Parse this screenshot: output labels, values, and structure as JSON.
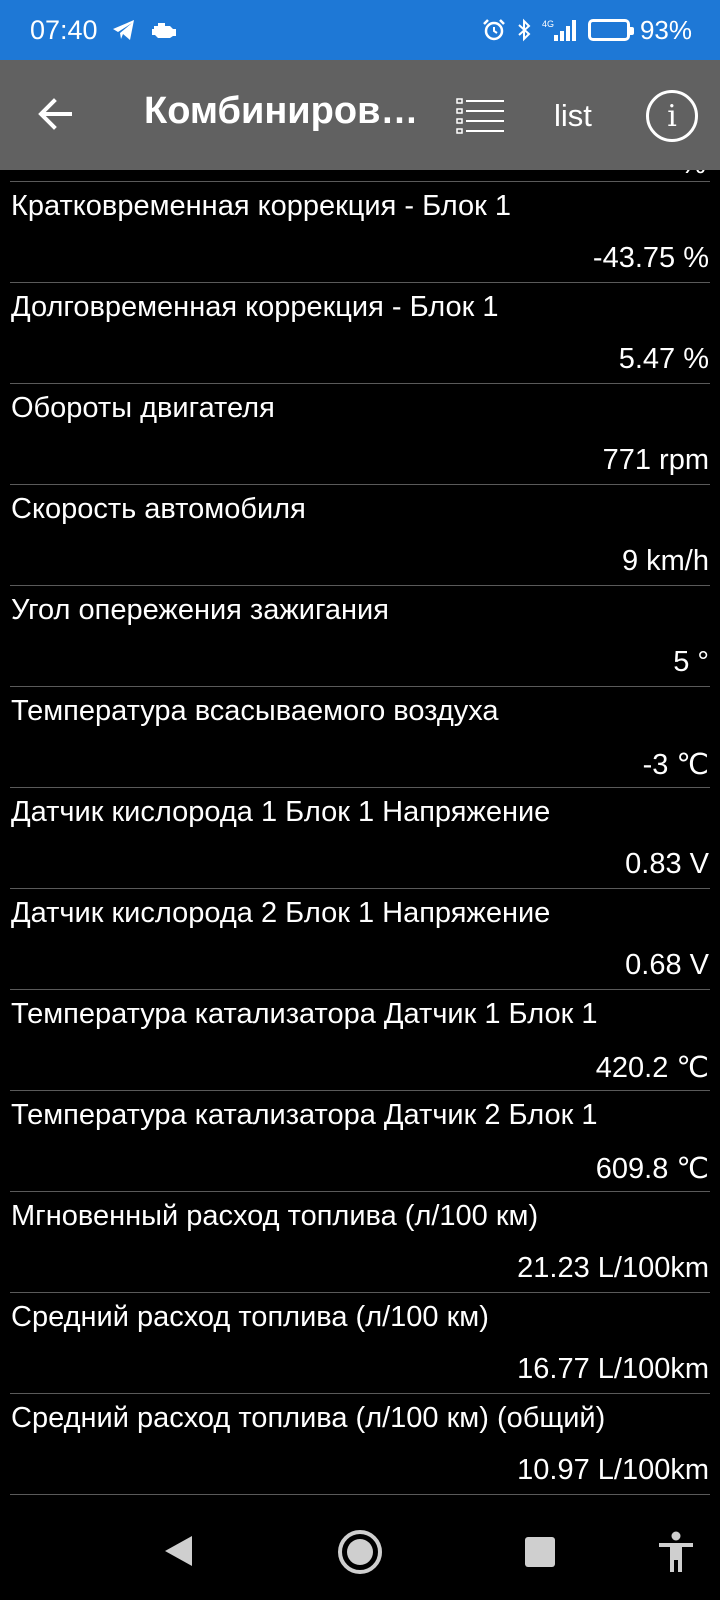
{
  "status_bar": {
    "time": "07:40",
    "left_icons": [
      "telegram-icon",
      "car-engine-icon"
    ],
    "right_icons": [
      "alarm-icon",
      "bluetooth-icon",
      "4g-signal-icon",
      "battery-icon"
    ],
    "network_label": "4G",
    "battery_percent": "93%",
    "battery_level": 0.93
  },
  "toolbar": {
    "title": "Комбиниров…",
    "list_label": "list",
    "info_label": "i"
  },
  "partial_value": "% ",
  "params": [
    {
      "name": "Кратковременная коррекция - Блок 1",
      "value": "-43.75 %"
    },
    {
      "name": "Долговременная коррекция - Блок 1",
      "value": "5.47 %"
    },
    {
      "name": "Обороты двигателя",
      "value": "771 rpm"
    },
    {
      "name": "Скорость автомобиля",
      "value": "9 km/h"
    },
    {
      "name": "Угол опережения зажигания",
      "value": "5 °"
    },
    {
      "name": "Температура всасываемого воздуха",
      "value": "-3 ℃"
    },
    {
      "name": "Датчик кислорода 1 Блок 1 Напряжение",
      "value": "0.83 V"
    },
    {
      "name": "Датчик кислорода 2 Блок 1 Напряжение",
      "value": "0.68 V"
    },
    {
      "name": "Температура катализатора Датчик 1 Блок 1",
      "value": "420.2 ℃"
    },
    {
      "name": "Температура катализатора Датчик 2 Блок 1",
      "value": "609.8 ℃"
    },
    {
      "name": "Мгновенный расход топлива (л/100 км)",
      "value": "21.23 L/100km"
    },
    {
      "name": "Средний расход топлива (л/100 км)",
      "value": "16.77 L/100km"
    },
    {
      "name": "Средний расход топлива (л/100 км) (общий)",
      "value": "10.97 L/100km"
    }
  ],
  "colors": {
    "status_bar": "#1e78d6",
    "toolbar": "#616161",
    "background": "#000000",
    "text": "#ffffff"
  }
}
